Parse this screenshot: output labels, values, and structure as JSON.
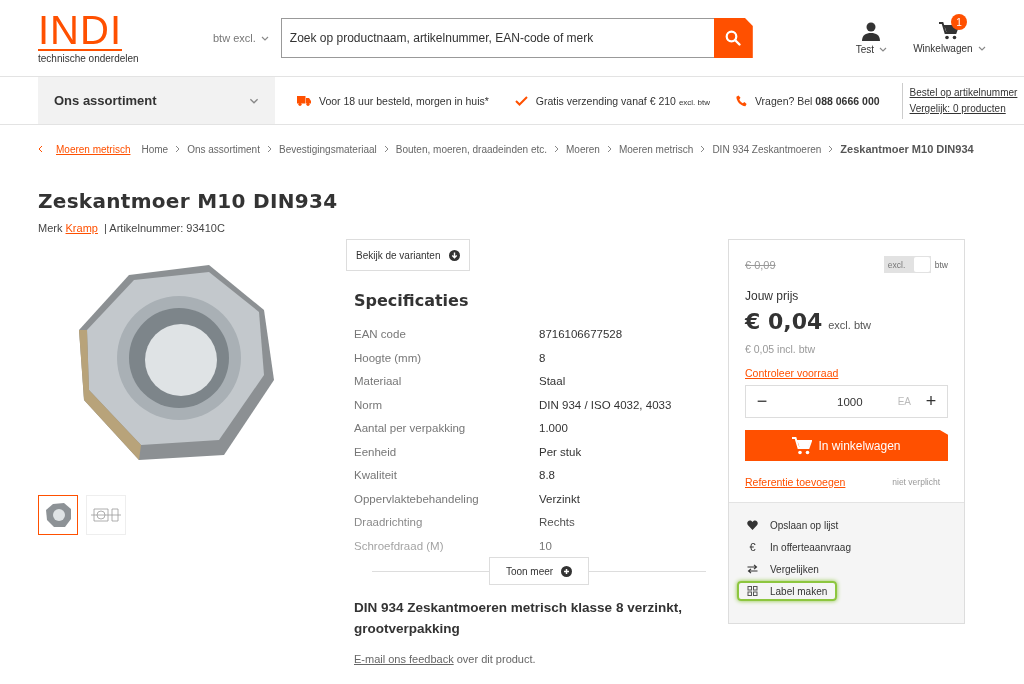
{
  "header": {
    "logo": {
      "title": "INDI",
      "subtitle": "technische onderdelen"
    },
    "vat_select": "btw excl.",
    "search": {
      "placeholder": "Zoek op productnaam, artikelnummer, EAN-code of merk"
    },
    "account": "Test",
    "cart": {
      "label": "Winkelwagen",
      "count": "1"
    }
  },
  "navbar": {
    "assortment": "Ons assortiment",
    "usps": [
      {
        "kind": "truck",
        "text": "Voor 18 uur besteld, morgen in huis*"
      },
      {
        "kind": "check",
        "text": "Gratis verzending vanaf € 210",
        "note": "excl. btw"
      },
      {
        "kind": "phone",
        "text": "Vragen? Bel **088 0666 000**"
      }
    ],
    "links": [
      "Bestel op artikelnummer",
      "Vergelijk: 0 producten"
    ]
  },
  "breadcrumb": {
    "back": "Moeren metrisch",
    "items": [
      "Home",
      "Ons assortiment",
      "Bevestigingsmateriaal",
      "Bouten, moeren, draadeinden etc.",
      "Moeren",
      "Moeren metrisch",
      "DIN 934 Zeskantmoeren"
    ],
    "current": "Zeskantmoer M10 DIN934"
  },
  "product": {
    "title": "Zeskantmoer M10 DIN934",
    "brand_label": "Merk",
    "brand": "Kramp",
    "article": "| Artikelnummer: 93410C",
    "thumbnails": [
      {
        "kind": "photo",
        "selected": true
      },
      {
        "kind": "drawing",
        "selected": false
      }
    ]
  },
  "specs": {
    "variants_button": "Bekijk de varianten",
    "title": "Specificaties",
    "rows": [
      {
        "label": "EAN code",
        "value": "8716106677528"
      },
      {
        "label": "Hoogte (mm)",
        "value": "8"
      },
      {
        "label": "Materiaal",
        "value": "Staal"
      },
      {
        "label": "Norm",
        "value": "DIN 934 / ISO 4032, 4033"
      },
      {
        "label": "Aantal per verpakking",
        "value": "1.000"
      },
      {
        "label": "Eenheid",
        "value": "Per stuk"
      },
      {
        "label": "Kwaliteit",
        "value": "8.8"
      },
      {
        "label": "Oppervlaktebehandeling",
        "value": "Verzinkt"
      },
      {
        "label": "Draadrichting",
        "value": "Rechts"
      },
      {
        "label": "Schroefdraad (M)",
        "value": "10"
      }
    ],
    "more_button": "Toon meer",
    "description": "DIN 934 Zeskantmoeren metrisch klasse 8 verzinkt, grootverpakking",
    "feedback_link": "E-mail ons feedback",
    "feedback_text": "over dit product."
  },
  "buy_box": {
    "old_price": "€ 0,09",
    "vat_toggle": {
      "left": "excl.",
      "right": "btw",
      "on": true
    },
    "price_label": "Jouw prijs",
    "price": "€ 0,04",
    "price_note": "excl. btw",
    "incl_price": "€ 0,05 incl. btw",
    "stock_link": "Controleer voorraad",
    "quantity": {
      "minus": "−",
      "value": "1000",
      "unit": "EA",
      "plus": "+"
    },
    "add_button": "In winkelwagen",
    "reference_link": "Referentie toevoegen",
    "reference_note": "niet verplicht",
    "actions": [
      {
        "kind": "heart",
        "label": "Opslaan op lijst",
        "highlighted": false
      },
      {
        "kind": "euro",
        "icon": "€",
        "label": "In offerteaanvraag",
        "highlighted": false
      },
      {
        "kind": "compare",
        "label": "Vergelijken",
        "highlighted": false
      },
      {
        "kind": "label",
        "label": "Label maken",
        "highlighted": true
      }
    ]
  }
}
